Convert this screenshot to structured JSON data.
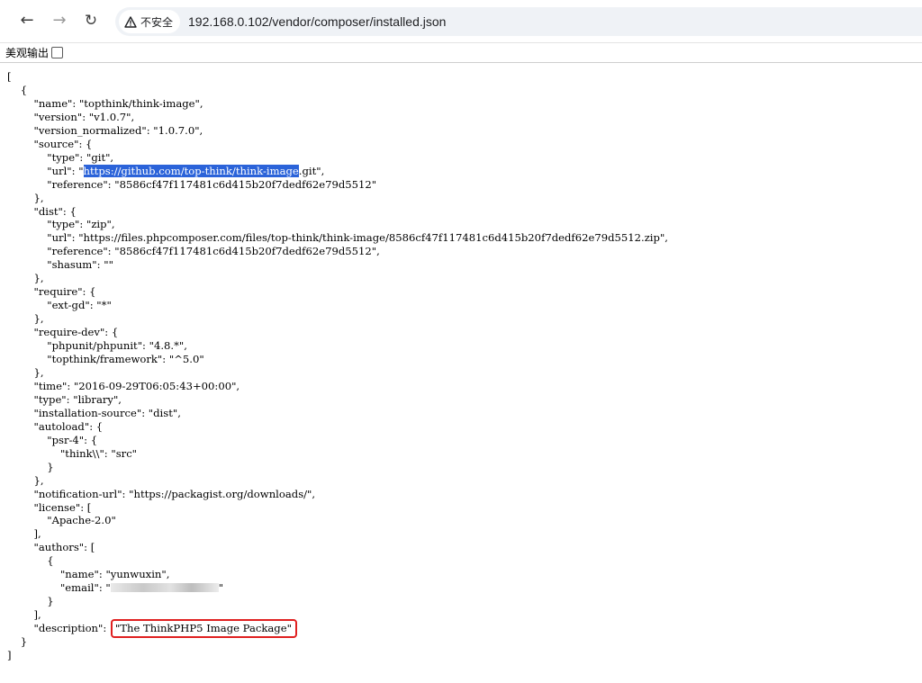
{
  "browser": {
    "security_label": "不安全",
    "url": "192.168.0.102/vendor/composer/installed.json"
  },
  "prettyprint": {
    "label": "美观输出",
    "checked": false
  },
  "json": {
    "open_bracket": "[",
    "close_bracket": "]",
    "obj_open": "{",
    "obj_close": "}",
    "name_line": "\"name\": \"topthink/think-image\",",
    "version_line": "\"version\": \"v1.0.7\",",
    "version_normalized_line": "\"version_normalized\": \"1.0.7.0\",",
    "source_open": "\"source\": {",
    "source_type": "\"type\": \"git\",",
    "source_url_prefix": "\"url\": \"",
    "source_url_highlight": "https://github.com/top-think/think-image",
    "source_url_suffix": ".git\",",
    "source_reference": "\"reference\": \"8586cf47f117481c6d415b20f7dedf62e79d5512\"",
    "obj_close_comma": "},",
    "dist_open": "\"dist\": {",
    "dist_type": "\"type\": \"zip\",",
    "dist_url": "\"url\": \"https://files.phpcomposer.com/files/top-think/think-image/8586cf47f117481c6d415b20f7dedf62e79d5512.zip\",",
    "dist_reference": "\"reference\": \"8586cf47f117481c6d415b20f7dedf62e79d5512\",",
    "dist_shasum": "\"shasum\": \"\"",
    "require_open": "\"require\": {",
    "require_ext_gd": "\"ext-gd\": \"*\"",
    "require_dev_open": "\"require-dev\": {",
    "require_dev_phpunit": "\"phpunit/phpunit\": \"4.8.*\",",
    "require_dev_framework": "\"topthink/framework\": \"^5.0\"",
    "time_line": "\"time\": \"2016-09-29T06:05:43+00:00\",",
    "type_line": "\"type\": \"library\",",
    "installation_source_line": "\"installation-source\": \"dist\",",
    "autoload_open": "\"autoload\": {",
    "psr4_open": "\"psr-4\": {",
    "psr4_think": "\"think\\\\\": \"src\"",
    "notification_url_line": "\"notification-url\": \"https://packagist.org/downloads/\",",
    "license_open": "\"license\": [",
    "license_value": "\"Apache-2.0\"",
    "array_close_comma": "],",
    "authors_open": "\"authors\": [",
    "author_name": "\"name\": \"yunwuxin\",",
    "author_email_prefix": "\"email\": \"",
    "author_email_suffix": "\"",
    "description_key": "\"description\": ",
    "description_value": "\"The ThinkPHP5 Image Package\""
  },
  "colors": {
    "highlight": "#2b63d9",
    "annotation_box": "#e02020"
  }
}
